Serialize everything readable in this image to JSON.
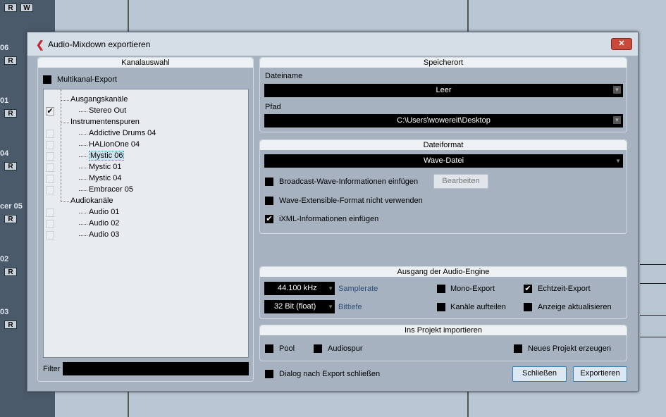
{
  "background": {
    "track_labels": [
      "06",
      "01",
      "04",
      "cer 05",
      "02",
      "03"
    ],
    "rec_label": "R",
    "write_label": "W"
  },
  "dialog": {
    "title": "Audio-Mixdown exportieren",
    "close_label": "✕"
  },
  "channel_selection": {
    "header": "Kanalauswahl",
    "multichannel_label": "Multikanal-Export",
    "multichannel_checked": false,
    "tree": [
      {
        "label": "Ausgangskanäle",
        "level": 0,
        "checkbox": false
      },
      {
        "label": "Stereo Out",
        "level": 1,
        "checkbox": true,
        "checked": true
      },
      {
        "label": "Instrumentenspuren",
        "level": 0,
        "checkbox": false
      },
      {
        "label": "Addictive Drums 04",
        "level": 1,
        "checkbox": true,
        "checked": false
      },
      {
        "label": "HALionOne 04",
        "level": 1,
        "checkbox": true,
        "checked": false
      },
      {
        "label": "Mystic 06",
        "level": 1,
        "checkbox": true,
        "checked": false,
        "selected": true
      },
      {
        "label": "Mystic 01",
        "level": 1,
        "checkbox": true,
        "checked": false
      },
      {
        "label": "Mystic 04",
        "level": 1,
        "checkbox": true,
        "checked": false
      },
      {
        "label": "Embracer 05",
        "level": 1,
        "checkbox": true,
        "checked": false
      },
      {
        "label": "Audiokanäle",
        "level": 0,
        "checkbox": false
      },
      {
        "label": "Audio 01",
        "level": 1,
        "checkbox": true,
        "checked": false
      },
      {
        "label": "Audio 02",
        "level": 1,
        "checkbox": true,
        "checked": false
      },
      {
        "label": "Audio 03",
        "level": 1,
        "checkbox": true,
        "checked": false
      }
    ],
    "filter_label": "Filter",
    "filter_value": ""
  },
  "location": {
    "header": "Speicherort",
    "filename_label": "Dateiname",
    "filename_value": "Leer",
    "path_label": "Pfad",
    "path_value": "C:\\Users\\wowereit\\Desktop"
  },
  "format": {
    "header": "Dateiformat",
    "format_value": "Wave-Datei",
    "broadcast_label": "Broadcast-Wave-Informationen einfügen",
    "edit_label": "Bearbeiten",
    "extensible_label": "Wave-Extensible-Format nicht verwenden",
    "ixml_label": "iXML-Informationen einfügen"
  },
  "engine": {
    "header": "Ausgang der Audio-Engine",
    "samplerate_value": "44.100 kHz",
    "samplerate_label": "Samplerate",
    "bitdepth_value": "32 Bit (float)",
    "bitdepth_label": "Bittiefe",
    "mono_label": "Mono-Export",
    "realtime_label": "Echtzeit-Export",
    "split_label": "Kanäle aufteilen",
    "update_label": "Anzeige aktualisieren"
  },
  "import": {
    "header": "Ins Projekt importieren",
    "pool_label": "Pool",
    "audiotrack_label": "Audiospur",
    "newproject_label": "Neues Projekt erzeugen"
  },
  "footer": {
    "close_after_label": "Dialog nach Export schließen",
    "close_button": "Schließen",
    "export_button": "Exportieren"
  }
}
